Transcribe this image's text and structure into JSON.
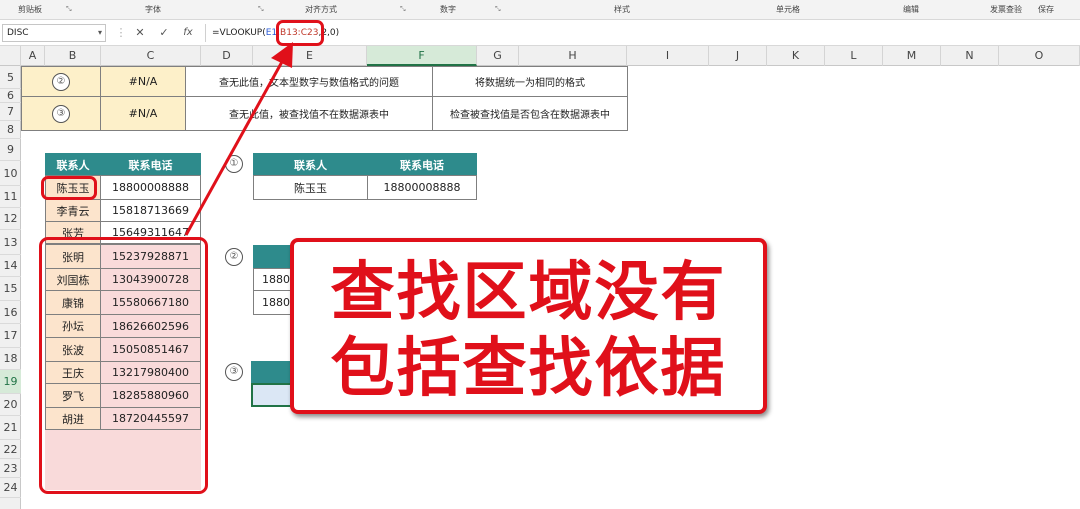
{
  "ribbon": {
    "groups": [
      "剪贴板",
      "字体",
      "对齐方式",
      "数字",
      "样式",
      "单元格",
      "编辑",
      "发票查验",
      "保存"
    ]
  },
  "formula_bar": {
    "name_box": "DISC",
    "cancel_icon": "✕",
    "enter_icon": "✓",
    "fx_label": "fx",
    "formula_prefix": "=VLOOKUP(",
    "formula_ref1": "E1",
    "formula_sep": ",",
    "formula_ref2": "B13:C23",
    "formula_suffix": ",2,0)"
  },
  "column_headers": [
    "A",
    "B",
    "C",
    "D",
    "E",
    "F",
    "G",
    "H",
    "I",
    "J",
    "K",
    "L",
    "M",
    "N",
    "O"
  ],
  "row_headers": [
    "5",
    "6",
    "7",
    "8",
    "9",
    "10",
    "11",
    "12",
    "13",
    "14",
    "15",
    "16",
    "17",
    "18",
    "19",
    "20",
    "21",
    "22",
    "23",
    "24"
  ],
  "top_table": {
    "rows": [
      {
        "num": "②",
        "error": "#N/A",
        "reason": "查无此值，文本型数字与数值格式的问题",
        "fix": "将数据统一为相同的格式"
      },
      {
        "num": "③",
        "error": "#N/A",
        "reason": "查无此值，被查找值不在数据源表中",
        "fix": "检查被查找值是否包含在数据源表中"
      }
    ]
  },
  "contacts": {
    "headers": [
      "联系人",
      "联系电话"
    ],
    "rows": [
      [
        "陈玉玉",
        "18800008888"
      ],
      [
        "李青云",
        "15818713669"
      ],
      [
        "张芳",
        "15649311647"
      ],
      [
        "张明",
        "15237928871"
      ],
      [
        "刘国栋",
        "13043900728"
      ],
      [
        "康锦",
        "15580667180"
      ],
      [
        "孙坛",
        "18626602596"
      ],
      [
        "张波",
        "15050851467"
      ],
      [
        "王庆",
        "13217980400"
      ],
      [
        "罗飞",
        "18285880960"
      ],
      [
        "胡进",
        "18720445597"
      ]
    ]
  },
  "lookup1": {
    "num": "①",
    "headers": [
      "联系人",
      "联系电话"
    ],
    "row": [
      "陈玉玉",
      "18800008888"
    ]
  },
  "lookup2": {
    "num": "②",
    "visible_values": [
      "1880",
      "1880"
    ]
  },
  "lookup3": {
    "num": "③"
  },
  "callout": {
    "line1": "查找区域没有",
    "line2": "包括查找依据"
  },
  "colors": {
    "header_teal": "#2e8b8c",
    "error_cell_bg": "#fdf0c9",
    "name_bg": "#fce4cc",
    "highlight_bg": "#f9dada",
    "accent_red": "#e0101a",
    "selection_green": "#217346"
  }
}
